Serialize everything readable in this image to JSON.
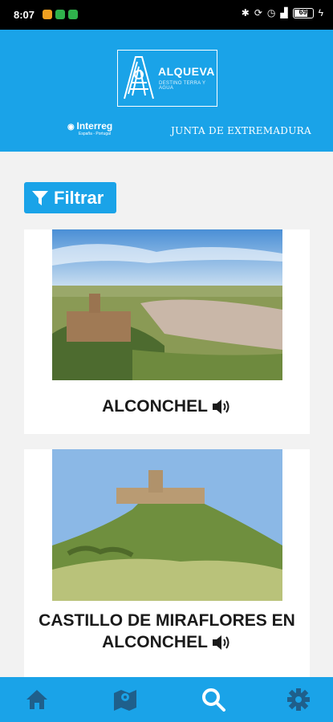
{
  "status": {
    "time": "8:07",
    "battery": "69"
  },
  "header": {
    "logo_title": "ALQUEVA",
    "logo_subtitle": "DESTINO TERRA Y AGUA",
    "interreg": "Interreg",
    "interreg_sub": "España - Portugal",
    "junta": "JUNTA DE EXTREMADURA"
  },
  "filter": {
    "label": "Filtrar"
  },
  "cards": [
    {
      "title": "ALCONCHEL"
    },
    {
      "title_line1": "CASTILLO DE MIRAFLORES EN",
      "title_line2": "ALCONCHEL"
    }
  ],
  "nav": [
    "home-icon",
    "map-icon",
    "search-icon",
    "settings-icon"
  ],
  "colors": {
    "brand": "#1aa3e8",
    "background": "#f2f2f2"
  }
}
